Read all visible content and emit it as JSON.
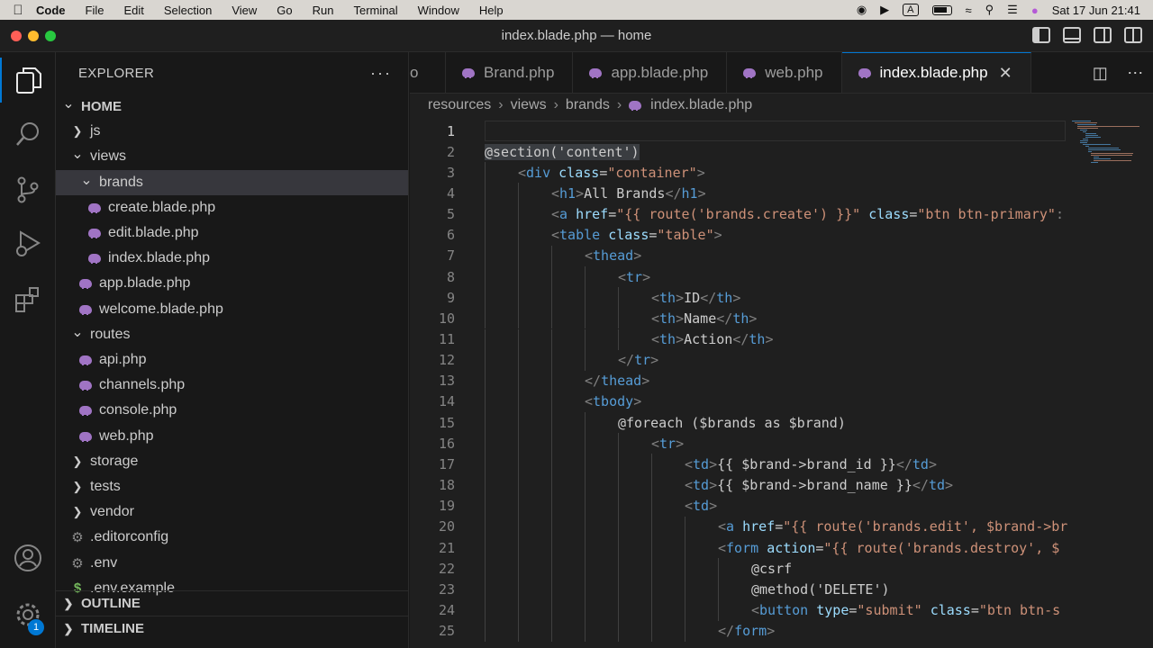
{
  "menubar": {
    "app": "Code",
    "items": [
      "File",
      "Edit",
      "Selection",
      "View",
      "Go",
      "Run",
      "Terminal",
      "Window",
      "Help"
    ],
    "datetime": "Sat 17 Jun  21:41"
  },
  "window": {
    "title": "index.blade.php — home"
  },
  "activity_bar": {
    "items": [
      "explorer-icon",
      "search-icon",
      "source-control-icon",
      "run-debug-icon",
      "extensions-icon",
      "account-icon",
      "manage-gear-icon"
    ],
    "badge": "1"
  },
  "explorer": {
    "title": "EXPLORER",
    "more": "···",
    "tree": [
      {
        "label": "HOME",
        "type": "root",
        "expanded": true
      },
      {
        "label": "js",
        "type": "folder",
        "expanded": false
      },
      {
        "label": "views",
        "type": "folder",
        "expanded": true
      },
      {
        "label": "brands",
        "type": "folder",
        "expanded": true,
        "selected": true
      },
      {
        "label": "create.blade.php",
        "type": "php"
      },
      {
        "label": "edit.blade.php",
        "type": "php"
      },
      {
        "label": "index.blade.php",
        "type": "php"
      },
      {
        "label": "app.blade.php",
        "type": "php"
      },
      {
        "label": "welcome.blade.php",
        "type": "php"
      },
      {
        "label": "routes",
        "type": "folder",
        "expanded": true
      },
      {
        "label": "api.php",
        "type": "php"
      },
      {
        "label": "channels.php",
        "type": "php"
      },
      {
        "label": "console.php",
        "type": "php"
      },
      {
        "label": "web.php",
        "type": "php"
      },
      {
        "label": "storage",
        "type": "folder",
        "expanded": false
      },
      {
        "label": "tests",
        "type": "folder",
        "expanded": false
      },
      {
        "label": "vendor",
        "type": "folder",
        "expanded": false
      },
      {
        "label": ".editorconfig",
        "type": "config"
      },
      {
        "label": ".env",
        "type": "config"
      },
      {
        "label": ".env.example",
        "type": "env"
      }
    ],
    "outline": "OUTLINE",
    "timeline": "TIMELINE"
  },
  "tabs": [
    {
      "label": "o",
      "partial": true
    },
    {
      "label": "Brand.php"
    },
    {
      "label": "app.blade.php"
    },
    {
      "label": "web.php"
    },
    {
      "label": "index.blade.php",
      "active": true,
      "close": "✕"
    }
  ],
  "breadcrumb": [
    "resources",
    "views",
    "brands",
    "index.blade.php"
  ],
  "code": {
    "lines": [
      {
        "n": "1",
        "indent": 0,
        "tokens": []
      },
      {
        "n": "2",
        "indent": 0,
        "tokens": [
          [
            "hl",
            "@section('content')"
          ]
        ]
      },
      {
        "n": "3",
        "indent": 1,
        "tokens": [
          [
            "br",
            "<"
          ],
          [
            "tag",
            "div"
          ],
          [
            "kw",
            " "
          ],
          [
            "attr",
            "class"
          ],
          [
            "kw",
            "="
          ],
          [
            "str",
            "\"container\""
          ],
          [
            "br",
            ">"
          ]
        ]
      },
      {
        "n": "4",
        "indent": 2,
        "tokens": [
          [
            "br",
            "<"
          ],
          [
            "tag",
            "h1"
          ],
          [
            "br",
            ">"
          ],
          [
            "kw",
            "All Brands"
          ],
          [
            "br",
            "</"
          ],
          [
            "tag",
            "h1"
          ],
          [
            "br",
            ">"
          ]
        ]
      },
      {
        "n": "5",
        "indent": 2,
        "tokens": [
          [
            "br",
            "<"
          ],
          [
            "tag",
            "a"
          ],
          [
            "kw",
            " "
          ],
          [
            "attr",
            "href"
          ],
          [
            "kw",
            "="
          ],
          [
            "str",
            "\"{{ route('brands.create') }}\""
          ],
          [
            "kw",
            " "
          ],
          [
            "attr",
            "class"
          ],
          [
            "kw",
            "="
          ],
          [
            "str",
            "\"btn btn-primary\""
          ],
          [
            "br",
            ":"
          ]
        ]
      },
      {
        "n": "6",
        "indent": 2,
        "tokens": [
          [
            "br",
            "<"
          ],
          [
            "tag",
            "table"
          ],
          [
            "kw",
            " "
          ],
          [
            "attr",
            "class"
          ],
          [
            "kw",
            "="
          ],
          [
            "str",
            "\"table\""
          ],
          [
            "br",
            ">"
          ]
        ]
      },
      {
        "n": "7",
        "indent": 3,
        "tokens": [
          [
            "br",
            "<"
          ],
          [
            "tag",
            "thead"
          ],
          [
            "br",
            ">"
          ]
        ]
      },
      {
        "n": "8",
        "indent": 4,
        "tokens": [
          [
            "br",
            "<"
          ],
          [
            "tag",
            "tr"
          ],
          [
            "br",
            ">"
          ]
        ]
      },
      {
        "n": "9",
        "indent": 5,
        "tokens": [
          [
            "br",
            "<"
          ],
          [
            "tag",
            "th"
          ],
          [
            "br",
            ">"
          ],
          [
            "kw",
            "ID"
          ],
          [
            "br",
            "</"
          ],
          [
            "tag",
            "th"
          ],
          [
            "br",
            ">"
          ]
        ]
      },
      {
        "n": "10",
        "indent": 5,
        "tokens": [
          [
            "br",
            "<"
          ],
          [
            "tag",
            "th"
          ],
          [
            "br",
            ">"
          ],
          [
            "kw",
            "Name"
          ],
          [
            "br",
            "</"
          ],
          [
            "tag",
            "th"
          ],
          [
            "br",
            ">"
          ]
        ]
      },
      {
        "n": "11",
        "indent": 5,
        "tokens": [
          [
            "br",
            "<"
          ],
          [
            "tag",
            "th"
          ],
          [
            "br",
            ">"
          ],
          [
            "kw",
            "Action"
          ],
          [
            "br",
            "</"
          ],
          [
            "tag",
            "th"
          ],
          [
            "br",
            ">"
          ]
        ]
      },
      {
        "n": "12",
        "indent": 4,
        "tokens": [
          [
            "br",
            "</"
          ],
          [
            "tag",
            "tr"
          ],
          [
            "br",
            ">"
          ]
        ]
      },
      {
        "n": "13",
        "indent": 3,
        "tokens": [
          [
            "br",
            "</"
          ],
          [
            "tag",
            "thead"
          ],
          [
            "br",
            ">"
          ]
        ]
      },
      {
        "n": "14",
        "indent": 3,
        "tokens": [
          [
            "br",
            "<"
          ],
          [
            "tag",
            "tbody"
          ],
          [
            "br",
            ">"
          ]
        ]
      },
      {
        "n": "15",
        "indent": 4,
        "tokens": [
          [
            "dir",
            "@foreach ($brands as $brand)"
          ]
        ]
      },
      {
        "n": "16",
        "indent": 5,
        "tokens": [
          [
            "br",
            "<"
          ],
          [
            "tag",
            "tr"
          ],
          [
            "br",
            ">"
          ]
        ]
      },
      {
        "n": "17",
        "indent": 6,
        "tokens": [
          [
            "br",
            "<"
          ],
          [
            "tag",
            "td"
          ],
          [
            "br",
            ">"
          ],
          [
            "kw",
            "{{ $brand->brand_id }}"
          ],
          [
            "br",
            "</"
          ],
          [
            "tag",
            "td"
          ],
          [
            "br",
            ">"
          ]
        ]
      },
      {
        "n": "18",
        "indent": 6,
        "tokens": [
          [
            "br",
            "<"
          ],
          [
            "tag",
            "td"
          ],
          [
            "br",
            ">"
          ],
          [
            "kw",
            "{{ $brand->brand_name }}"
          ],
          [
            "br",
            "</"
          ],
          [
            "tag",
            "td"
          ],
          [
            "br",
            ">"
          ]
        ]
      },
      {
        "n": "19",
        "indent": 6,
        "tokens": [
          [
            "br",
            "<"
          ],
          [
            "tag",
            "td"
          ],
          [
            "br",
            ">"
          ]
        ]
      },
      {
        "n": "20",
        "indent": 7,
        "tokens": [
          [
            "br",
            "<"
          ],
          [
            "tag",
            "a"
          ],
          [
            "kw",
            " "
          ],
          [
            "attr",
            "href"
          ],
          [
            "kw",
            "="
          ],
          [
            "str",
            "\"{{ route('brands.edit', $brand->br"
          ]
        ]
      },
      {
        "n": "21",
        "indent": 7,
        "tokens": [
          [
            "br",
            "<"
          ],
          [
            "tag",
            "form"
          ],
          [
            "kw",
            " "
          ],
          [
            "attr",
            "action"
          ],
          [
            "kw",
            "="
          ],
          [
            "str",
            "\"{{ route('brands.destroy', $"
          ]
        ]
      },
      {
        "n": "22",
        "indent": 8,
        "tokens": [
          [
            "dir",
            "@csrf"
          ]
        ]
      },
      {
        "n": "23",
        "indent": 8,
        "tokens": [
          [
            "dir",
            "@method('DELETE')"
          ]
        ]
      },
      {
        "n": "24",
        "indent": 8,
        "tokens": [
          [
            "br",
            "<"
          ],
          [
            "tag",
            "button"
          ],
          [
            "kw",
            " "
          ],
          [
            "attr",
            "type"
          ],
          [
            "kw",
            "="
          ],
          [
            "str",
            "\"submit\""
          ],
          [
            "kw",
            " "
          ],
          [
            "attr",
            "class"
          ],
          [
            "kw",
            "="
          ],
          [
            "str",
            "\"btn btn-s"
          ]
        ]
      },
      {
        "n": "25",
        "indent": 7,
        "tokens": [
          [
            "br",
            "</"
          ],
          [
            "tag",
            "form"
          ],
          [
            "br",
            ">"
          ]
        ]
      }
    ]
  },
  "colors": {
    "accent": "#0078d4",
    "php_icon": "#a074c4",
    "tag": "#569cd6",
    "attr": "#9cdcfe",
    "string": "#ce9178"
  }
}
